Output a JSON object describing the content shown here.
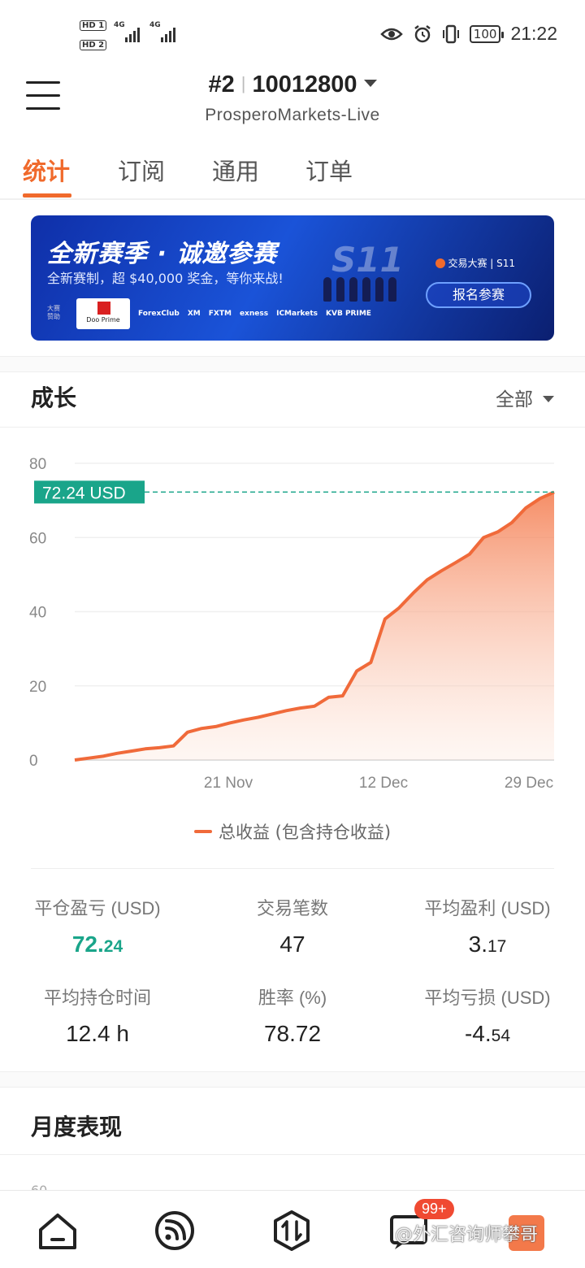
{
  "status_bar": {
    "sim1": "HD 1",
    "sim2": "HD 2",
    "net1": "4G",
    "net2": "4G",
    "battery": "100",
    "time": "21:22"
  },
  "header": {
    "rank": "#2",
    "account_number": "10012800",
    "server": "ProsperoMarkets-Live"
  },
  "tabs": [
    {
      "label": "统计",
      "active": true
    },
    {
      "label": "订阅",
      "active": false
    },
    {
      "label": "通用",
      "active": false
    },
    {
      "label": "订单",
      "active": false
    }
  ],
  "banner": {
    "title": "全新赛季 · 诚邀参赛",
    "subtitle": "全新赛制，超 $40,000 奖金，等你来战!",
    "season": "S11",
    "brand": "交易大赛 | S11",
    "cta": "报名参赛",
    "sponsor_label": "大赛赞助",
    "sponsors": [
      "Doo Prime",
      "ForexClub",
      "XM",
      "FXTM",
      "exness",
      "ICMarkets",
      "KVB PRIME"
    ]
  },
  "growth": {
    "title": "成长",
    "range": "全部"
  },
  "chart_data": {
    "type": "area",
    "current_label": "72.24 USD",
    "current_value": 72.24,
    "ylim": [
      0,
      80
    ],
    "yticks": [
      "0",
      "20",
      "40",
      "60",
      "80"
    ],
    "xticks": [
      "21 Nov",
      "12 Dec",
      "29 Dec"
    ],
    "series": [
      {
        "name": "总收益 (包含持仓收益)",
        "color": "#f06a3a",
        "values": [
          0,
          0.5,
          1,
          1.8,
          2.4,
          3,
          3.3,
          3.8,
          7.5,
          8.5,
          9,
          10,
          10.8,
          11.5,
          12.4,
          13.3,
          14,
          14.5,
          16.9,
          17.3,
          24,
          26.3,
          38,
          41,
          45,
          48.6,
          51,
          53.2,
          55.5,
          60,
          61.5,
          64,
          68,
          70.5,
          72.24
        ]
      }
    ]
  },
  "stats": [
    {
      "label": "平仓盈亏 (USD)",
      "int": "72.",
      "dec": "24",
      "highlight": true
    },
    {
      "label": "交易笔数",
      "int": "47",
      "dec": "",
      "highlight": false
    },
    {
      "label": "平均盈利 (USD)",
      "int": "3.",
      "dec": "17",
      "highlight": false
    },
    {
      "label": "平均持仓时间",
      "int": "12.4 h",
      "dec": "",
      "highlight": false
    },
    {
      "label": "胜率 (%)",
      "int": "78.72",
      "dec": "",
      "highlight": false
    },
    {
      "label": "平均亏损 (USD)",
      "int": "-4.",
      "dec": "54",
      "highlight": false
    }
  ],
  "monthly": {
    "title": "月度表现",
    "tick": "60"
  },
  "bottom_nav": {
    "badge": "99+",
    "watermark": "@外汇咨询师攀哥",
    "items": [
      "home-icon",
      "feed-icon",
      "trade-icon",
      "messages-icon",
      "profile-icon"
    ]
  }
}
